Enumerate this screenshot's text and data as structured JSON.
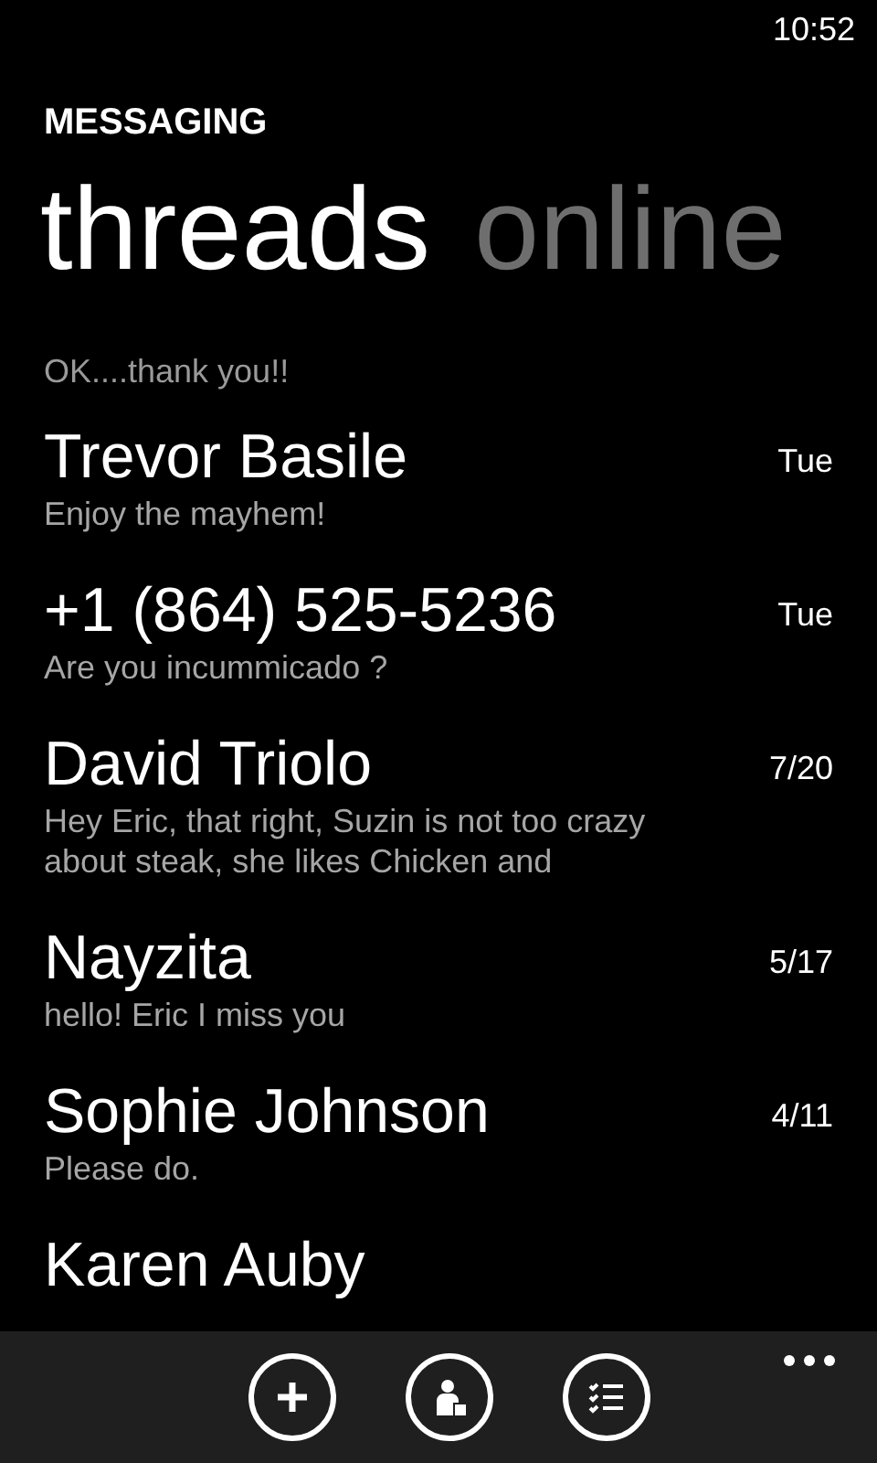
{
  "status_bar": {
    "time": "10:52"
  },
  "app_title": "MESSAGING",
  "pivot": [
    {
      "label": "threads",
      "selected": true
    },
    {
      "label": "online",
      "selected": false
    }
  ],
  "partial_preview": "OK....thank you!!",
  "threads": [
    {
      "name": "Trevor Basile",
      "preview": "Enjoy the mayhem!",
      "date": "Tue"
    },
    {
      "name": "+1 (864) 525-5236",
      "preview": "Are you incummicado ?",
      "date": "Tue"
    },
    {
      "name": "David Triolo",
      "preview": "Hey Eric, that right, Suzin is not too crazy about steak, she likes Chicken and",
      "date": "7/20"
    },
    {
      "name": "Nayzita",
      "preview": "hello! Eric I miss you",
      "date": "5/17"
    },
    {
      "name": "Sophie Johnson",
      "preview": "Please do.",
      "date": "4/11"
    },
    {
      "name": "Karen Auby"
    }
  ],
  "app_bar": {
    "buttons": [
      {
        "kind": "new"
      },
      {
        "kind": "contact"
      },
      {
        "kind": "select"
      }
    ]
  }
}
